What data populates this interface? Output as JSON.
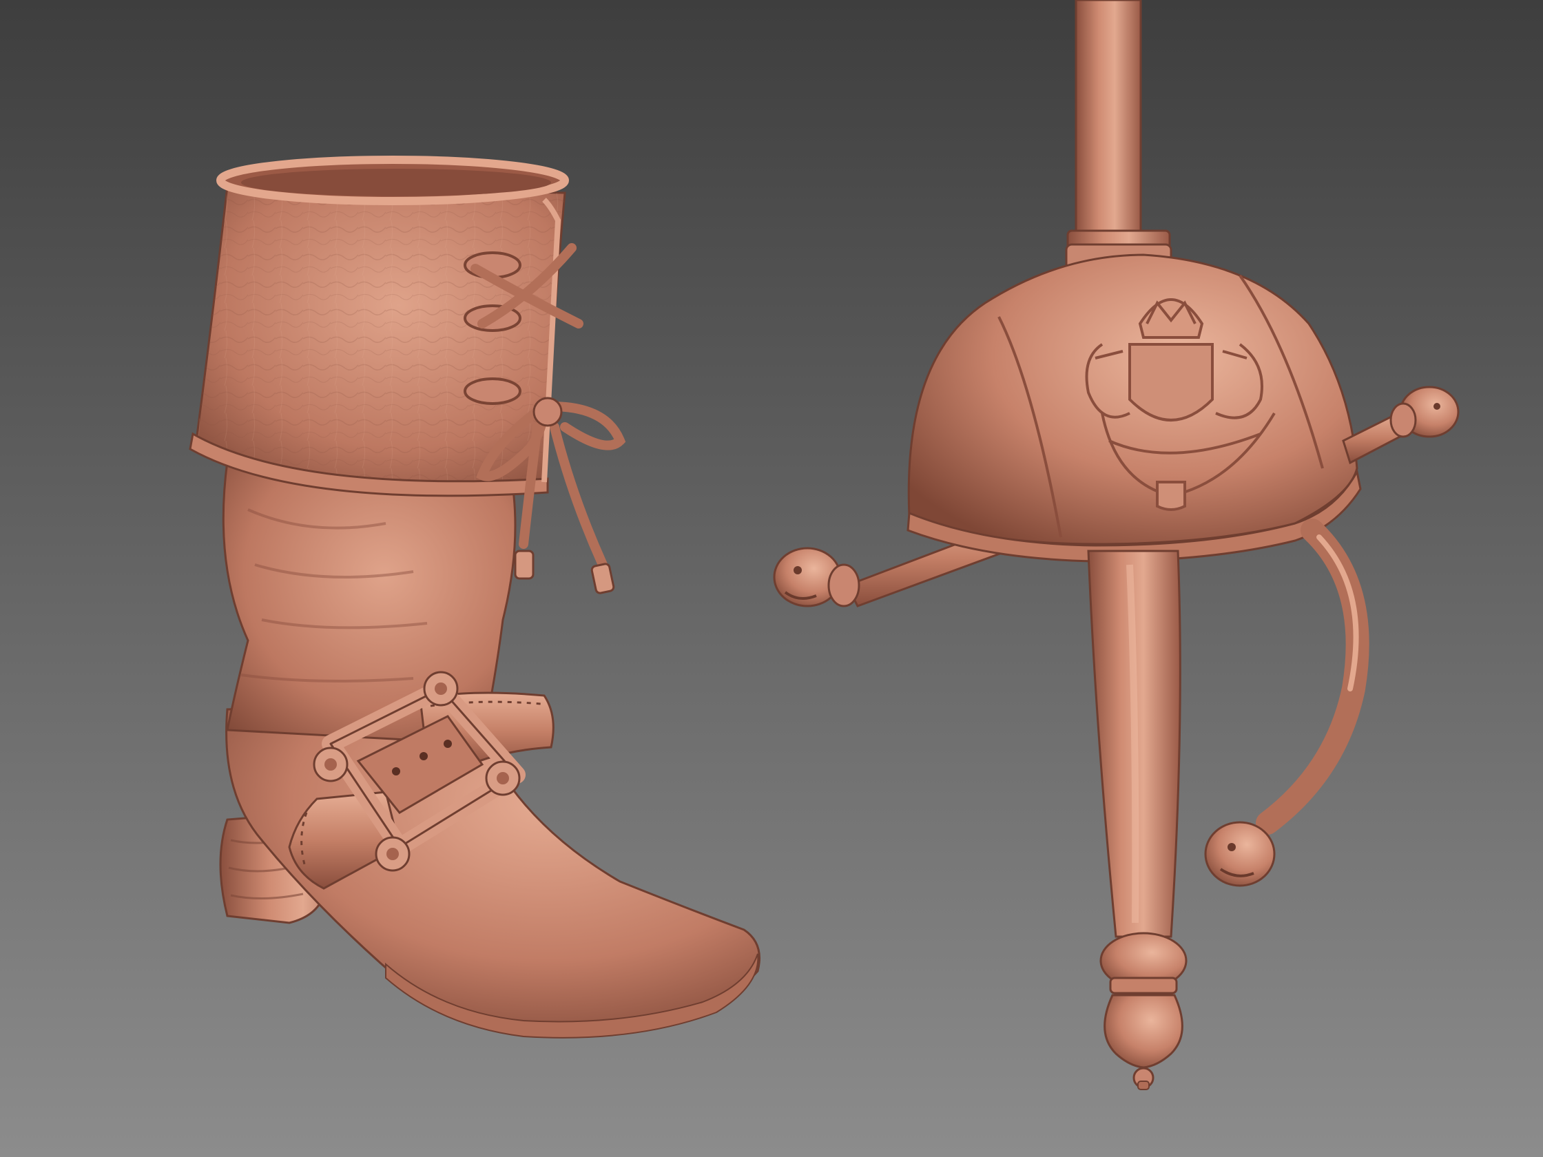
{
  "scene": {
    "background": {
      "top_color": "#3f3f3f",
      "bottom_color": "#868686"
    },
    "material_color": "#c9826b",
    "material_highlight": "#e8b39c",
    "material_shadow": "#7a4535",
    "objects": [
      {
        "name": "boot",
        "parts": [
          "cuff",
          "lacing-bow",
          "aglets",
          "shaft",
          "buckle-strap",
          "buckle",
          "rosettes",
          "heel",
          "toe"
        ]
      },
      {
        "name": "sword-hilt",
        "parts": [
          "blade",
          "ferrule",
          "cup-guard",
          "coat-of-arms-emblem",
          "quillons",
          "lion-head-terminals",
          "knuckle-bow",
          "grip",
          "pommel"
        ]
      }
    ]
  }
}
